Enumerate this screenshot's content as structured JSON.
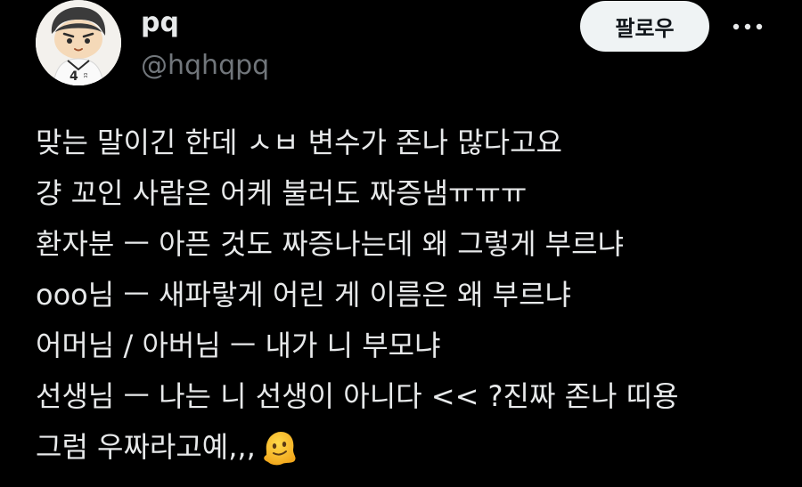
{
  "user": {
    "display_name": "pq",
    "handle": "@hqhqpq",
    "avatar_icon": "plush-doll-avatar-icon"
  },
  "actions": {
    "follow_label": "팔로우",
    "more_icon": "more-options-icon"
  },
  "tweet": {
    "lines": [
      "맞는 말이긴 한데 ㅅㅂ 변수가 존나 많다고요",
      "걍 꼬인 사람은 어케 불러도 짜증냄ㅠㅠㅠ",
      "환자분 ㅡ 아픈 것도 짜증나는데 왜 그렇게 부르냐",
      "ooo님 ㅡ 새파랗게 어린 게 이름은 왜 부르냐",
      "어머님 / 아버님 ㅡ 내가 니 부모냐",
      "선생님 ㅡ 나는 니 선생이 아니다 << ?진짜 존나 띠용",
      "그럼 우짜라고예,,,"
    ],
    "trailing_emoji": "melting-face-emoji"
  },
  "colors": {
    "background": "#000000",
    "primary_text": "#e7e9ea",
    "secondary_text": "#71767b",
    "follow_bg": "#eff3f4",
    "follow_text": "#0f1419"
  }
}
